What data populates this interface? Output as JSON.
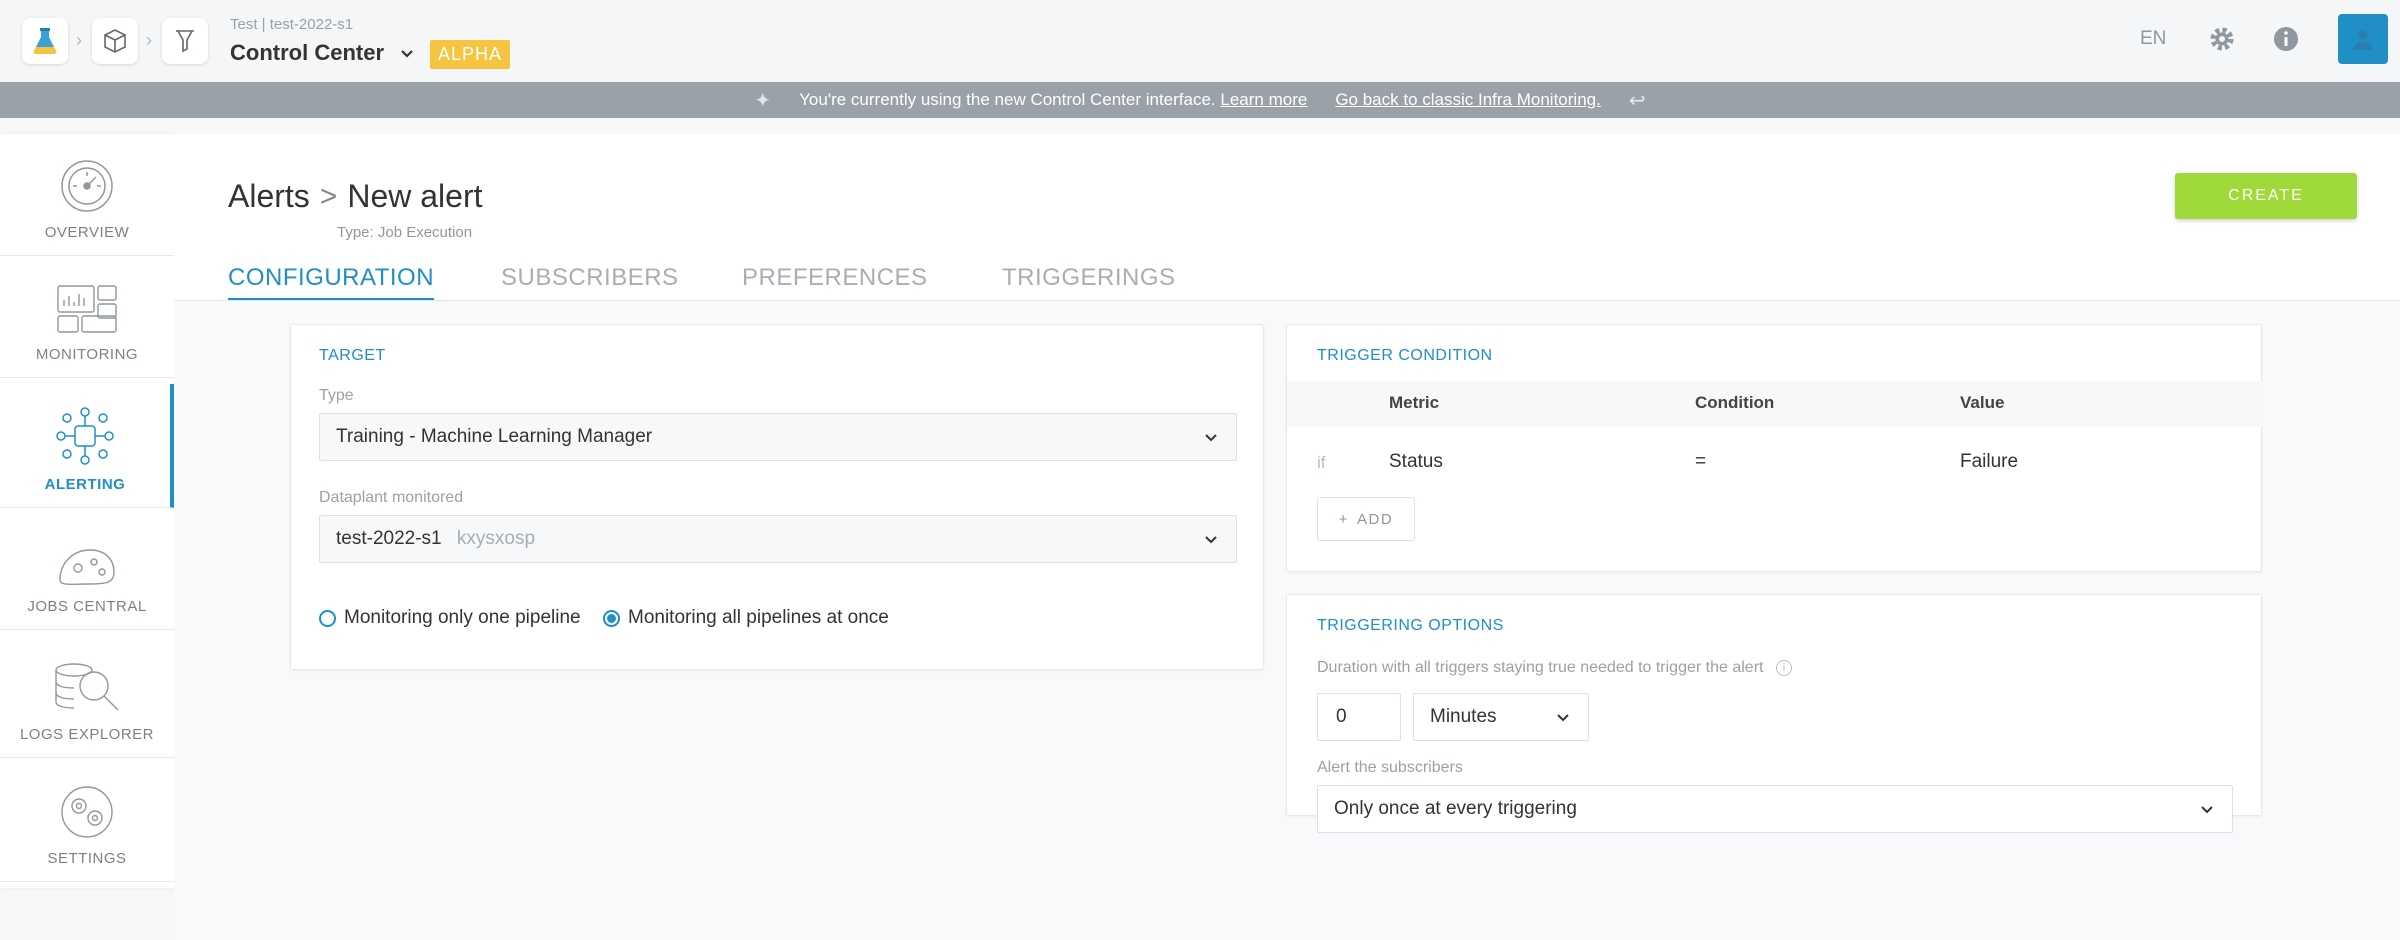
{
  "topbar": {
    "project_sub": "Test | test-2022-s1",
    "app_title": "Control Center",
    "badge": "ALPHA",
    "lang": "EN"
  },
  "banner": {
    "text": "You're currently using the new Control Center interface.",
    "learn_more": "Learn more",
    "go_back": "Go back to classic Infra Monitoring."
  },
  "sidebar": {
    "items": [
      {
        "label": "OVERVIEW",
        "icon": "gauge-icon"
      },
      {
        "label": "MONITORING",
        "icon": "dashboard-icon"
      },
      {
        "label": "ALERTING",
        "icon": "alert-network-icon"
      },
      {
        "label": "JOBS CENTRAL",
        "icon": "jobs-icon"
      },
      {
        "label": "LOGS EXPLORER",
        "icon": "logs-search-icon"
      },
      {
        "label": "SETTINGS",
        "icon": "settings-icon"
      }
    ]
  },
  "page": {
    "breadcrumb_root": "Alerts",
    "breadcrumb_sep": ">",
    "title": "New alert",
    "type": "Type: Job Execution",
    "create_label": "CREATE",
    "tabs": [
      "CONFIGURATION",
      "SUBSCRIBERS",
      "PREFERENCES",
      "TRIGGERINGS"
    ]
  },
  "target": {
    "title": "TARGET",
    "type_label": "Type",
    "type_value": "Training - Machine Learning Manager",
    "dataplant_label": "Dataplant monitored",
    "dataplant_value": "test-2022-s1",
    "dataplant_id": "kxysxosp",
    "radio_one": "Monitoring only one pipeline",
    "radio_all": "Monitoring all pipelines at once"
  },
  "trigger": {
    "title": "TRIGGER CONDITION",
    "col_metric": "Metric",
    "col_condition": "Condition",
    "col_value": "Value",
    "row_if": "if",
    "row_metric": "Status",
    "row_condition": "=",
    "row_value": "Failure",
    "add_label": "ADD"
  },
  "options": {
    "title": "TRIGGERING OPTIONS",
    "duration_label": "Duration with all triggers staying true needed to trigger the alert",
    "duration_value": "0",
    "unit_value": "Minutes",
    "alert_label": "Alert the subscribers",
    "alert_value": "Only once at every triggering"
  },
  "colors": {
    "accent": "#1f8fc6",
    "create": "#9fd93a",
    "badge": "#f5c542"
  }
}
